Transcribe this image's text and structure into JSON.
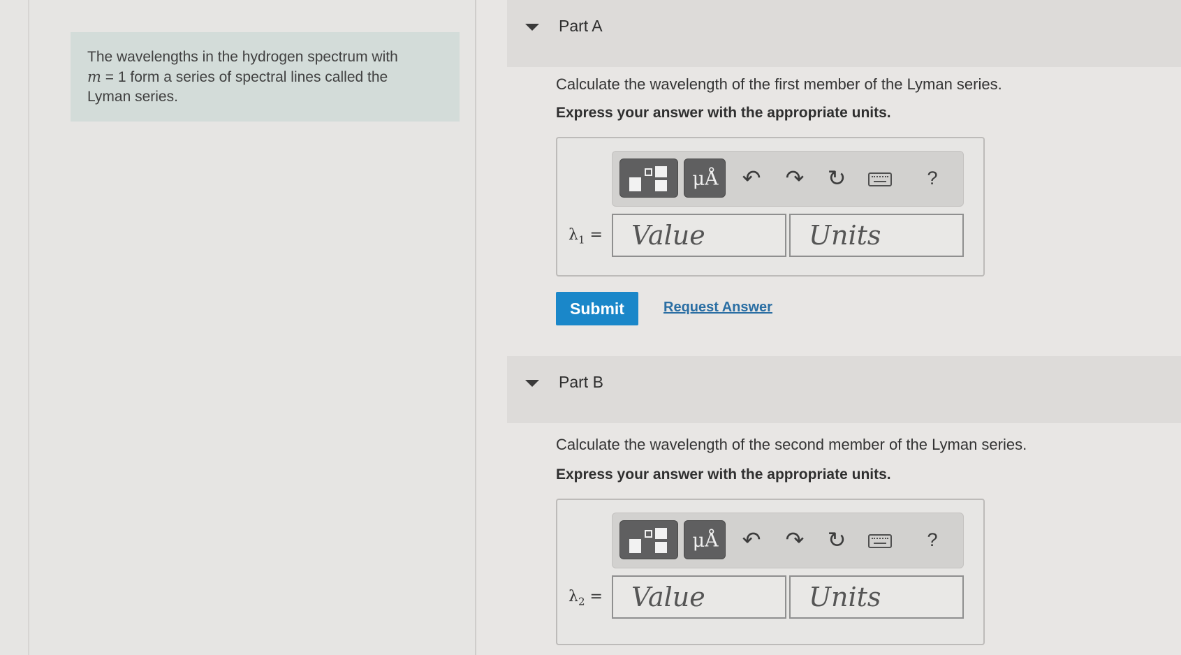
{
  "intro": {
    "line1": "The wavelengths in the hydrogen spectrum with",
    "var_m": "m",
    "line2_rest": " = 1 form a series of spectral lines called the",
    "line3": "Lyman series."
  },
  "parts": [
    {
      "title": "Part A",
      "question": "Calculate the wavelength of the first member of the Lyman series.",
      "instruction": "Express your answer with the appropriate units.",
      "var_symbol": "λ",
      "var_sub": "1",
      "var_eq": " =",
      "value_placeholder": "Value",
      "units_placeholder": "Units",
      "submit_label": "Submit",
      "request_label": "Request Answer"
    },
    {
      "title": "Part B",
      "question": "Calculate the wavelength of the second member of the Lyman series.",
      "instruction": "Express your answer with the appropriate units.",
      "var_symbol": "λ",
      "var_sub": "2",
      "var_eq": " =",
      "value_placeholder": "Value",
      "units_placeholder": "Units"
    }
  ],
  "toolbar": {
    "units_label": "μÅ",
    "undo_glyph": "↶",
    "redo_glyph": "↷",
    "reset_glyph": "↻",
    "help_label": "?"
  },
  "colors": {
    "submit_bg": "#1a87c9",
    "link": "#2a6ea3",
    "intro_bg": "#d3dcd9"
  }
}
